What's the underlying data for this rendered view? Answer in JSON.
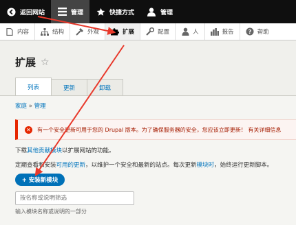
{
  "toolbar": {
    "items": [
      {
        "label": "返回网站",
        "icon": "chevron-left-icon"
      },
      {
        "label": "管理",
        "icon": "menu-icon"
      },
      {
        "label": "快捷方式",
        "icon": "star-icon"
      },
      {
        "label": "管理",
        "icon": "user-icon"
      }
    ]
  },
  "tray": {
    "items": [
      {
        "label": "内容",
        "icon": "file-icon"
      },
      {
        "label": "结构",
        "icon": "sitemap-icon"
      },
      {
        "label": "外观",
        "icon": "wrench-brush-icon"
      },
      {
        "label": "扩展",
        "icon": "puzzle-icon"
      },
      {
        "label": "配置",
        "icon": "wrench-icon"
      },
      {
        "label": "人",
        "icon": "people-icon"
      },
      {
        "label": "报告",
        "icon": "bar-chart-icon"
      },
      {
        "label": "帮助",
        "icon": "help-icon"
      }
    ]
  },
  "page": {
    "title": "扩展",
    "tabs": [
      "列表",
      "更新",
      "卸载"
    ],
    "breadcrumb": {
      "home": "家庭",
      "separator": "»",
      "current": "管理"
    },
    "alert": "有一个安全更新可用于您的 Drupal 版本。为了确保服务器的安全，您应该立即更新！ 有关详细信息",
    "para1": {
      "prefix": "下载",
      "link": "其他贡献模块",
      "suffix": "以扩展网站的功能。"
    },
    "para2": {
      "prefix": "定期查看和安装",
      "link1": "可用的更新",
      "middle": "，以维护一个安全和最新的站点。每次更新",
      "link2": "模块时",
      "suffix": "，始终运行更新脚本。"
    },
    "install_button": "+ 安装新模块",
    "filter_placeholder": "按名称或说明筛选",
    "filter_hint": "输入模块名称或说明的一部分"
  },
  "colors": {
    "accent": "#0074bd",
    "error": "#e62600",
    "annotation_arrow": "#e8392b"
  }
}
